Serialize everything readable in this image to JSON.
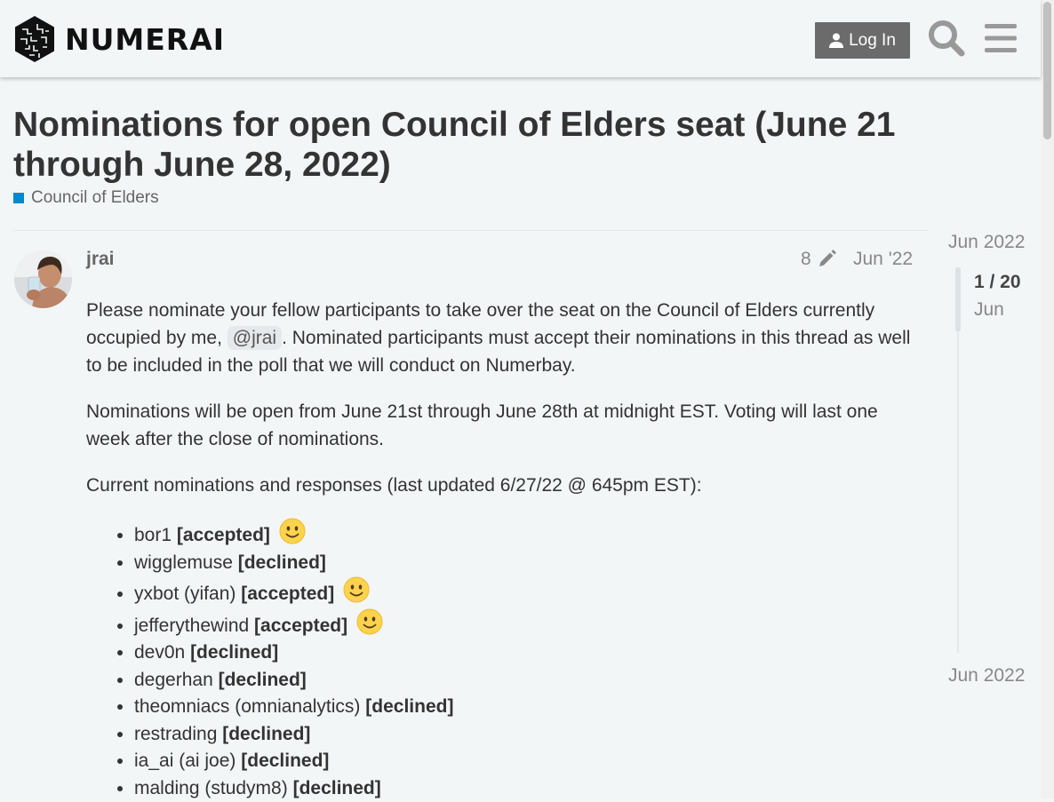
{
  "header": {
    "brand": "NUMERAI",
    "login_label": "Log In"
  },
  "topic": {
    "title": "Nominations for open Council of Elders seat (June 21 through June 28, 2022)",
    "category": "Council of Elders",
    "category_color": "#0088cc"
  },
  "post": {
    "username": "jrai",
    "edit_count": "8",
    "date": "Jun '22",
    "para1_before": "Please nominate your fellow participants to take over the seat on the Council of Elders currently occupied by me, ",
    "mention": "@jrai",
    "para1_after": ". Nominated participants must accept their nominations in this thread as well to be included in the poll that we will conduct on Numerbay.",
    "para2": "Nominations will be open from June 21st through June 28th at midnight EST. Voting will last one week after the close of nominations.",
    "para3": "Current nominations and responses (last updated 6/27/22 @ 645pm EST):",
    "nominations": [
      {
        "name": "bor1",
        "status": "[accepted]",
        "emoji": true
      },
      {
        "name": "wigglemuse",
        "status": "[declined]",
        "emoji": false
      },
      {
        "name": "yxbot (yifan)",
        "status": "[accepted]",
        "emoji": true
      },
      {
        "name": "jefferythewind",
        "status": "[accepted]",
        "emoji": true
      },
      {
        "name": "dev0n",
        "status": "[declined]",
        "emoji": false
      },
      {
        "name": "degerhan",
        "status": "[declined]",
        "emoji": false
      },
      {
        "name": "theomniacs (omnianalytics)",
        "status": "[declined]",
        "emoji": false
      },
      {
        "name": "restrading",
        "status": "[declined]",
        "emoji": false
      },
      {
        "name": "ia_ai (ai joe)",
        "status": "[declined]",
        "emoji": false
      },
      {
        "name": "malding (studym8)",
        "status": "[declined]",
        "emoji": false
      }
    ]
  },
  "timeline": {
    "start_date": "Jun 2022",
    "position": "1 / 20",
    "current_month": "Jun",
    "end_date": "Jun 2022"
  }
}
